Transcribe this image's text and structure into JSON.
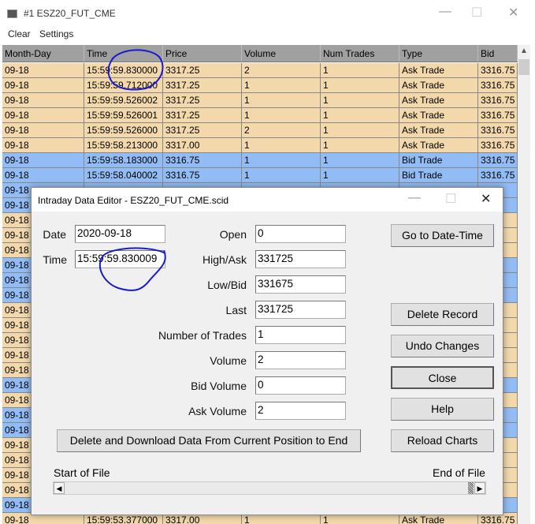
{
  "window": {
    "title": "#1 ESZ20_FUT_CME",
    "minimize": "—",
    "maximize": "☐",
    "close": "✕"
  },
  "menu": {
    "clear": "Clear",
    "settings": "Settings"
  },
  "table": {
    "headers": [
      "Month-Day",
      "Time",
      "Price",
      "Volume",
      "Num Trades",
      "Type",
      "Bid"
    ],
    "rows": [
      {
        "c": "tan",
        "v": [
          "09-18",
          "15:59:59.830000",
          "3317.25",
          "2",
          "1",
          "Ask Trade",
          "3316.75"
        ]
      },
      {
        "c": "tan",
        "v": [
          "09-18",
          "15:59:59.712000",
          "3317.25",
          "1",
          "1",
          "Ask Trade",
          "3316.75"
        ]
      },
      {
        "c": "tan",
        "v": [
          "09-18",
          "15:59:59.526002",
          "3317.25",
          "1",
          "1",
          "Ask Trade",
          "3316.75"
        ]
      },
      {
        "c": "tan",
        "v": [
          "09-18",
          "15:59:59.526001",
          "3317.25",
          "1",
          "1",
          "Ask Trade",
          "3316.75"
        ]
      },
      {
        "c": "tan",
        "v": [
          "09-18",
          "15:59:59.526000",
          "3317.25",
          "2",
          "1",
          "Ask Trade",
          "3316.75"
        ]
      },
      {
        "c": "tan",
        "v": [
          "09-18",
          "15:59:58.213000",
          "3317.00",
          "1",
          "1",
          "Ask Trade",
          "3316.75"
        ]
      },
      {
        "c": "blue",
        "v": [
          "09-18",
          "15:59:58.183000",
          "3316.75",
          "1",
          "1",
          "Bid Trade",
          "3316.75"
        ]
      },
      {
        "c": "blue",
        "v": [
          "09-18",
          "15:59:58.040002",
          "3316.75",
          "1",
          "1",
          "Bid Trade",
          "3316.75"
        ]
      },
      {
        "c": "blue",
        "v": [
          "09-18"
        ]
      },
      {
        "c": "blue",
        "v": [
          "09-18"
        ]
      },
      {
        "c": "tan",
        "v": [
          "09-18"
        ]
      },
      {
        "c": "tan",
        "v": [
          "09-18"
        ]
      },
      {
        "c": "tan",
        "v": [
          "09-18"
        ]
      },
      {
        "c": "blue",
        "v": [
          "09-18"
        ]
      },
      {
        "c": "blue",
        "v": [
          "09-18"
        ]
      },
      {
        "c": "blue",
        "v": [
          "09-18"
        ]
      },
      {
        "c": "tan",
        "v": [
          "09-18"
        ]
      },
      {
        "c": "tan",
        "v": [
          "09-18"
        ]
      },
      {
        "c": "tan",
        "v": [
          "09-18"
        ]
      },
      {
        "c": "tan",
        "v": [
          "09-18"
        ]
      },
      {
        "c": "tan",
        "v": [
          "09-18"
        ]
      },
      {
        "c": "blue",
        "v": [
          "09-18"
        ]
      },
      {
        "c": "tan",
        "v": [
          "09-18"
        ]
      },
      {
        "c": "blue",
        "v": [
          "09-18"
        ]
      },
      {
        "c": "blue",
        "v": [
          "09-18"
        ]
      },
      {
        "c": "tan",
        "v": [
          "09-18"
        ]
      },
      {
        "c": "tan",
        "v": [
          "09-18"
        ]
      },
      {
        "c": "tan",
        "v": [
          "09-18"
        ]
      },
      {
        "c": "tan",
        "v": [
          "09-18"
        ]
      },
      {
        "c": "blue",
        "v": [
          "09-18"
        ]
      },
      {
        "c": "tan",
        "v": [
          "09-18",
          "15:59:53.377000",
          "3317.00",
          "1",
          "1",
          "Ask Trade",
          "3316.75"
        ]
      }
    ]
  },
  "dialog": {
    "title": "Intraday Data Editor - ESZ20_FUT_CME.scid",
    "date_label": "Date",
    "date_value": "2020-09-18",
    "time_label": "Time",
    "time_value": "15:59:59.830009",
    "fields": [
      {
        "label": "Open",
        "value": "0"
      },
      {
        "label": "High/Ask",
        "value": "331725"
      },
      {
        "label": "Low/Bid",
        "value": "331675"
      },
      {
        "label": "Last",
        "value": "331725"
      },
      {
        "label": "Number of Trades",
        "value": "1"
      },
      {
        "label": "Volume",
        "value": "2"
      },
      {
        "label": "Bid Volume",
        "value": "0"
      },
      {
        "label": "Ask Volume",
        "value": "2"
      }
    ],
    "buttons": {
      "goto": "Go to Date-Time",
      "delete": "Delete  Record",
      "undo": "Undo Changes",
      "close": "Close",
      "help": "Help",
      "reload": "Reload Charts",
      "delete_download": "Delete and Download Data From Current Position to End"
    },
    "start_label": "Start of File",
    "end_label": "End of File"
  },
  "colors": {
    "tan": "#f2d8ab",
    "blue": "#92bcf5",
    "annotation": "#1a1ad0"
  }
}
